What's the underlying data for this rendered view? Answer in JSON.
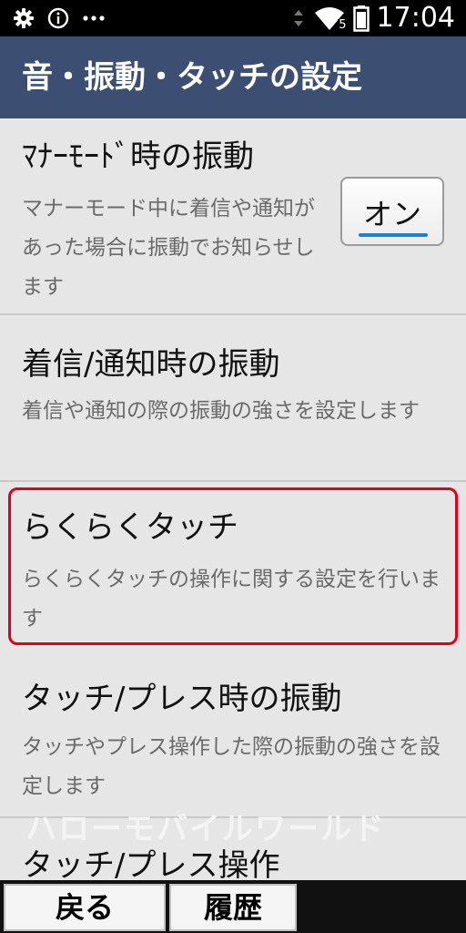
{
  "status_bar": {
    "left_icons": [
      "gear-icon",
      "info-icon",
      "more-icon"
    ],
    "right_icons": [
      "vibrate-icon",
      "wifi-icon",
      "battery-icon"
    ],
    "wifi_badge": "5",
    "time": "17:04"
  },
  "header": {
    "title": "音・振動・タッチの設定"
  },
  "settings": [
    {
      "title": "ﾏﾅｰﾓｰﾄﾞ時の振動",
      "description": "マナーモード中に着信や通知があった場合に振動でお知らせします",
      "toggle_label": "オン"
    },
    {
      "title": "着信/通知時の振動",
      "description": "着信や通知の際の振動の強さを設定します"
    },
    {
      "title": "らくらくタッチ",
      "description": "らくらくタッチの操作に関する設定を行います"
    },
    {
      "title": "タッチ/プレス時の振動",
      "description": "タッチやプレス操作した際の振動の強さを設定します"
    },
    {
      "title": "タッチ/プレス操作"
    }
  ],
  "watermark": "ハローモバイルワールド",
  "highlight_color": "#e0001a",
  "header_color": "#3d4e73",
  "bottom_bar": {
    "back_label": "戻る",
    "history_label": "履歴"
  }
}
